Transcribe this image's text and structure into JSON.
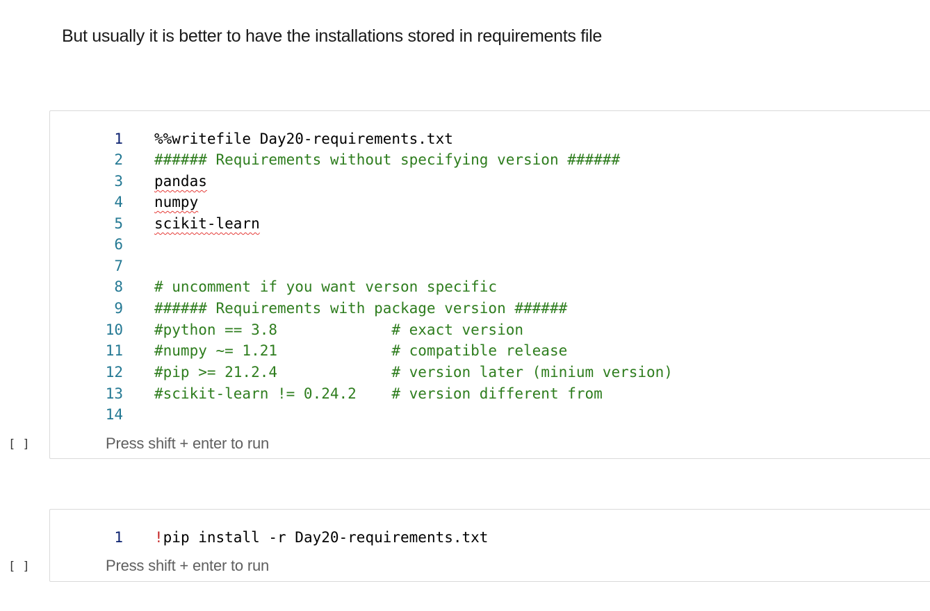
{
  "markdown": {
    "text": "But usually it is better to have the installations stored in requirements file"
  },
  "cells": [
    {
      "run_indicator": "[ ]",
      "hint": "Press shift + enter to run",
      "lines": [
        {
          "num": "1",
          "text": "%%writefile Day20-requirements.txt"
        },
        {
          "num": "2",
          "text": "###### Requirements without specifying version ######"
        },
        {
          "num": "3",
          "text": "pandas"
        },
        {
          "num": "4",
          "text": "numpy"
        },
        {
          "num": "5",
          "text": "scikit-learn"
        },
        {
          "num": "6",
          "text": ""
        },
        {
          "num": "7",
          "text": ""
        },
        {
          "num": "8",
          "text": "# uncomment if you want verson specific"
        },
        {
          "num": "9",
          "text": "###### Requirements with package version ######"
        },
        {
          "num": "10",
          "text": "#python == 3.8             # exact version"
        },
        {
          "num": "11",
          "text": "#numpy ~= 1.21             # compatible release"
        },
        {
          "num": "12",
          "text": "#pip >= 21.2.4             # version later (minium version)"
        },
        {
          "num": "13",
          "text": "#scikit-learn != 0.24.2    # version different from"
        },
        {
          "num": "14",
          "text": ""
        }
      ]
    },
    {
      "run_indicator": "[ ]",
      "hint": "Press shift + enter to run",
      "lines": [
        {
          "num": "1",
          "bang": "!",
          "text": "pip install -r Day20-requirements.txt"
        }
      ]
    }
  ],
  "colors": {
    "comment": "#2e7d1e",
    "line_number": "#237893",
    "active_line_number": "#0b216f",
    "shell_bang": "#c62828",
    "spellcheck": "#e53935"
  }
}
